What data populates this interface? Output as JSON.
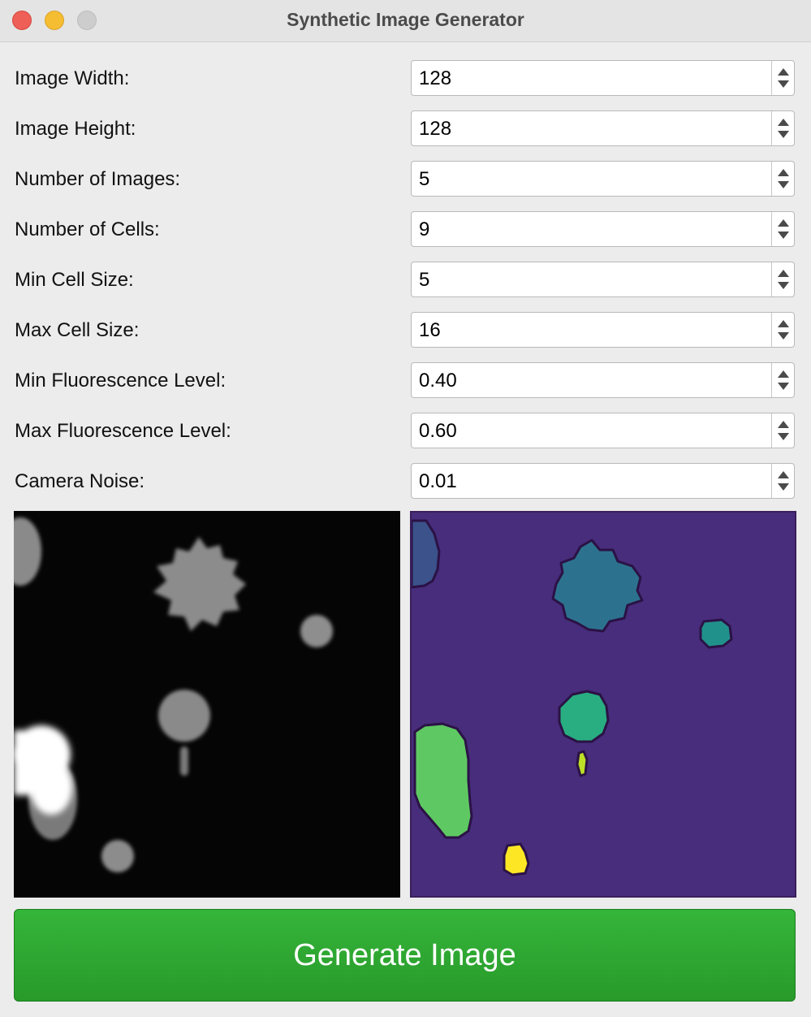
{
  "window": {
    "title": "Synthetic Image Generator"
  },
  "form": [
    {
      "label": "Image Width:",
      "value": "128"
    },
    {
      "label": "Image Height:",
      "value": "128"
    },
    {
      "label": "Number of Images:",
      "value": "5"
    },
    {
      "label": "Number of Cells:",
      "value": "9"
    },
    {
      "label": "Min Cell Size:",
      "value": "5"
    },
    {
      "label": "Max Cell Size:",
      "value": "16"
    },
    {
      "label": "Min Fluorescence Level:",
      "value": "0.40"
    },
    {
      "label": "Max Fluorescence Level:",
      "value": "0.60"
    },
    {
      "label": "Camera Noise:",
      "value": "0.01"
    }
  ],
  "images": {
    "grayscale_image": "synthetic-fluorescence-image",
    "label_image": "segmentation-label-image"
  },
  "colors": {
    "accent": "#2ba92e",
    "label_background": "#472d7b"
  },
  "generate_button": {
    "label": "Generate Image"
  }
}
